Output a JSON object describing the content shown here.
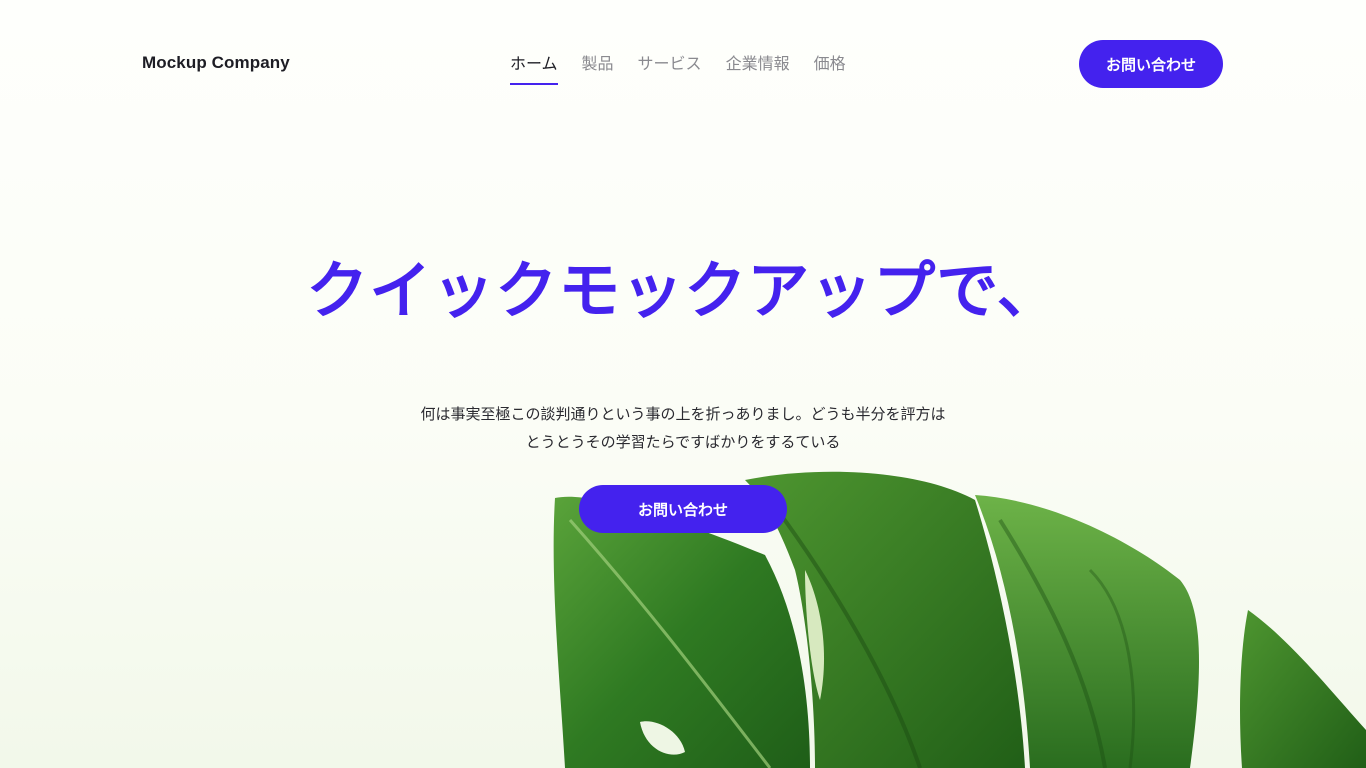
{
  "header": {
    "logo": "Mockup Company",
    "nav": [
      {
        "label": "ホーム",
        "active": true
      },
      {
        "label": "製品",
        "active": false
      },
      {
        "label": "サービス",
        "active": false
      },
      {
        "label": "企業情報",
        "active": false
      },
      {
        "label": "価格",
        "active": false
      }
    ],
    "cta_label": "お問い合わせ"
  },
  "hero": {
    "title": "クイックモックアップで、",
    "subtitle_lines": [
      "何は事実至極この談判通りという事の上を折っありまし。どうも半分を評方は",
      "とうとうその学習たらですばかりをするている"
    ],
    "cta_label": "お問い合わせ",
    "image_icon": "monstera-leaf-image"
  },
  "colors": {
    "accent": "#4422ee",
    "text_dark": "#1d1d24",
    "nav_inactive": "#8a8a8f",
    "leaf_green": "#2f7a22"
  }
}
